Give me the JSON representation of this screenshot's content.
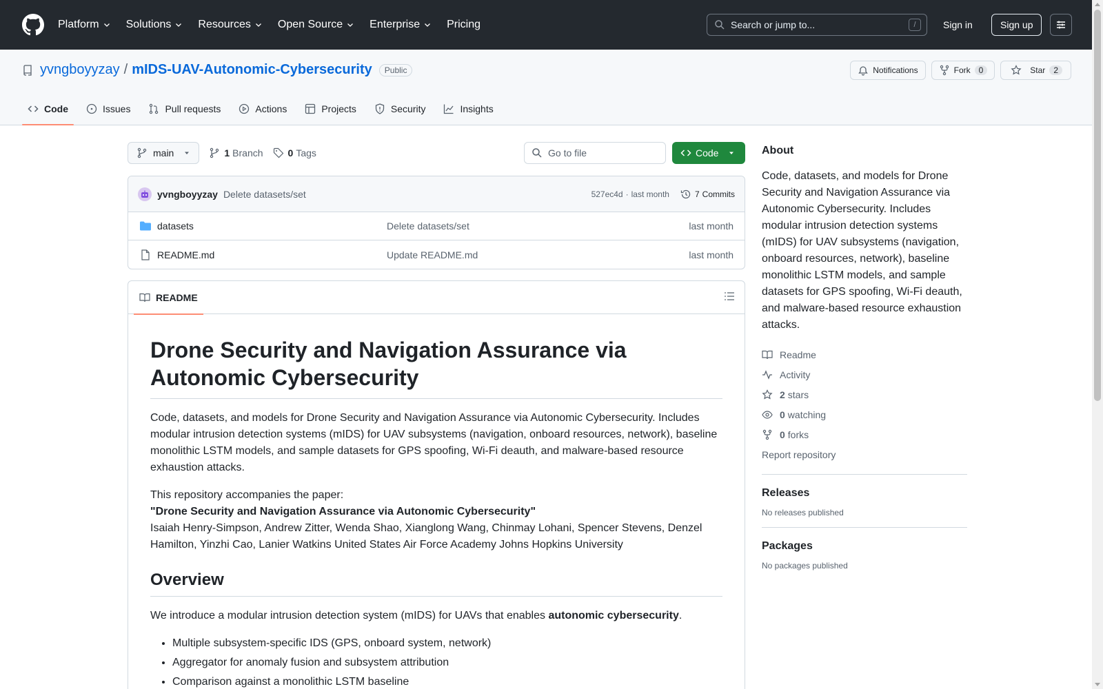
{
  "header": {
    "nav": [
      "Platform",
      "Solutions",
      "Resources",
      "Open Source",
      "Enterprise",
      "Pricing"
    ],
    "search_placeholder": "Search or jump to...",
    "search_shortcut": "/",
    "sign_in": "Sign in",
    "sign_up": "Sign up"
  },
  "repo": {
    "owner": "yvngboyyzay",
    "separator": "/",
    "name": "mIDS-UAV-Autonomic-Cybersecurity",
    "visibility": "Public",
    "notifications_label": "Notifications",
    "fork_label": "Fork",
    "fork_count": "0",
    "star_label": "Star",
    "star_count": "2",
    "tabs": [
      "Code",
      "Issues",
      "Pull requests",
      "Actions",
      "Projects",
      "Security",
      "Insights"
    ]
  },
  "file_nav": {
    "branch": "main",
    "branch_count": "1",
    "branch_label": "Branch",
    "tag_count": "0",
    "tag_label": "Tags",
    "goto_placeholder": "Go to file",
    "code_button": "Code"
  },
  "latest_commit": {
    "author": "yvngboyyzay",
    "message": "Delete datasets/set",
    "hash": "527ec4d",
    "dot": "·",
    "time": "last month",
    "commits_count": "7",
    "commits_label": "Commits"
  },
  "files": [
    {
      "name": "datasets",
      "type": "folder",
      "message": "Delete datasets/set",
      "date": "last month"
    },
    {
      "name": "README.md",
      "type": "file",
      "message": "Update README.md",
      "date": "last month"
    }
  ],
  "readme": {
    "tab_label": "README",
    "h1": "Drone Security and Navigation Assurance via Autonomic Cybersecurity",
    "intro": "Code, datasets, and models for Drone Security and Navigation Assurance via Autonomic Cybersecurity. Includes modular intrusion detection systems (mIDS) for UAV subsystems (navigation, onboard resources, network), baseline monolithic LSTM models, and sample datasets for GPS spoofing, Wi-Fi deauth, and malware-based resource exhaustion attacks.",
    "paper_line": "This repository accompanies the paper:",
    "paper_title": "\"Drone Security and Navigation Assurance via Autonomic Cybersecurity\"",
    "authors": "Isaiah Henry-Simpson, Andrew Zitter, Wenda Shao, Xianglong Wang, Chinmay Lohani, Spencer Stevens, Denzel Hamilton, Yinzhi Cao, Lanier Watkins United States Air Force Academy Johns Hopkins University",
    "h2_overview": "Overview",
    "overview_text": "We introduce a modular intrusion detection system (mIDS) for UAVs that enables ",
    "overview_bold": "autonomic cybersecurity",
    "overview_end": ".",
    "bullets": [
      "Multiple subsystem-specific IDS (GPS, onboard system, network)",
      "Aggregator for anomaly fusion and subsystem attribution",
      "Comparison against a monolithic LSTM baseline"
    ]
  },
  "sidebar": {
    "about_heading": "About",
    "about_text": "Code, datasets, and models for Drone Security and Navigation Assurance via Autonomic Cybersecurity. Includes modular intrusion detection systems (mIDS) for UAV subsystems (navigation, onboard resources, network), baseline monolithic LSTM models, and sample datasets for GPS spoofing, Wi-Fi deauth, and malware-based resource exhaustion attacks.",
    "readme_link": "Readme",
    "activity_link": "Activity",
    "stars_count": "2",
    "stars_label": "stars",
    "watching_count": "0",
    "watching_label": "watching",
    "forks_count": "0",
    "forks_label": "forks",
    "report_link": "Report repository",
    "releases_heading": "Releases",
    "releases_text": "No releases published",
    "packages_heading": "Packages",
    "packages_text": "No packages published"
  },
  "colors": {
    "header_bg": "#24292f",
    "link_blue": "#0969da",
    "code_button_green": "#1f883d",
    "active_tab_underline": "#fd8c73",
    "folder_blue": "#54aeff"
  },
  "icons": {
    "header": [
      "github-logo-icon",
      "search-icon",
      "menu-icon"
    ],
    "repo_tabs": [
      "code-icon",
      "issue-icon",
      "pull-request-icon",
      "play-icon",
      "table-icon",
      "shield-icon",
      "graph-icon"
    ]
  }
}
